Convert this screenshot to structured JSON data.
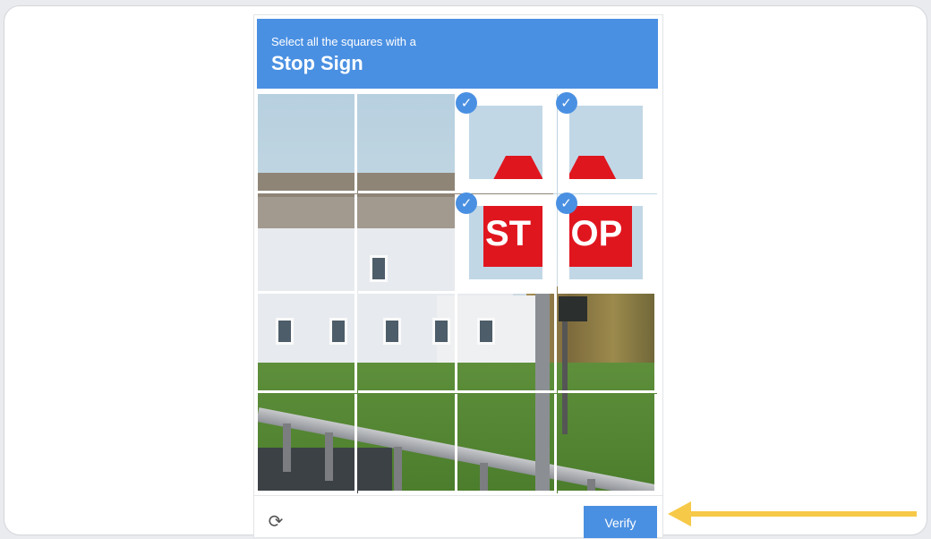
{
  "challenge": {
    "instruction": "Select all the squares with a",
    "target": "Stop Sign"
  },
  "grid": {
    "rows": 4,
    "cols": 4,
    "selected": [
      [
        0,
        2
      ],
      [
        0,
        3
      ],
      [
        1,
        2
      ],
      [
        1,
        3
      ]
    ]
  },
  "stop_text": "STOP",
  "footer": {
    "reload_icon": "reload-icon",
    "verify_label": "Verify"
  },
  "colors": {
    "accent": "#4a90e2",
    "arrow": "#f7c948",
    "stop_red": "#e0161f"
  }
}
